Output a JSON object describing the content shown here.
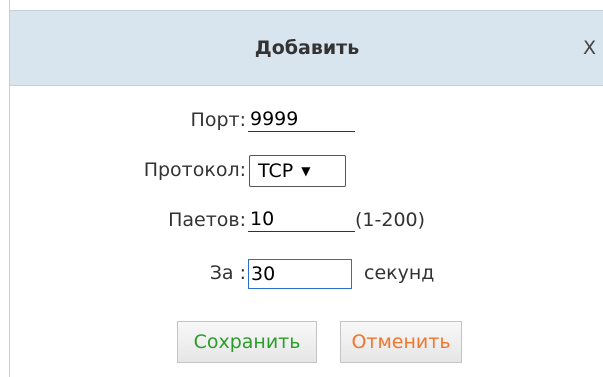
{
  "dialog": {
    "title": "Добавить",
    "close_label": "X"
  },
  "form": {
    "port_label": "Порт:",
    "port_value": "9999",
    "protocol_label": "Протокол:",
    "protocol_value": "TCP",
    "packets_label": "Паетов:",
    "packets_value": "10",
    "packets_hint": "(1-200)",
    "interval_label": "За :",
    "interval_value": "30",
    "interval_unit": "секунд"
  },
  "buttons": {
    "save_label": "Сохранить",
    "cancel_label": "Отменить"
  },
  "colors": {
    "titlebar": "#d8e4ee",
    "save_text": "#2a9d2a",
    "cancel_text": "#f0762e",
    "focus_border": "#2b6fc9"
  }
}
